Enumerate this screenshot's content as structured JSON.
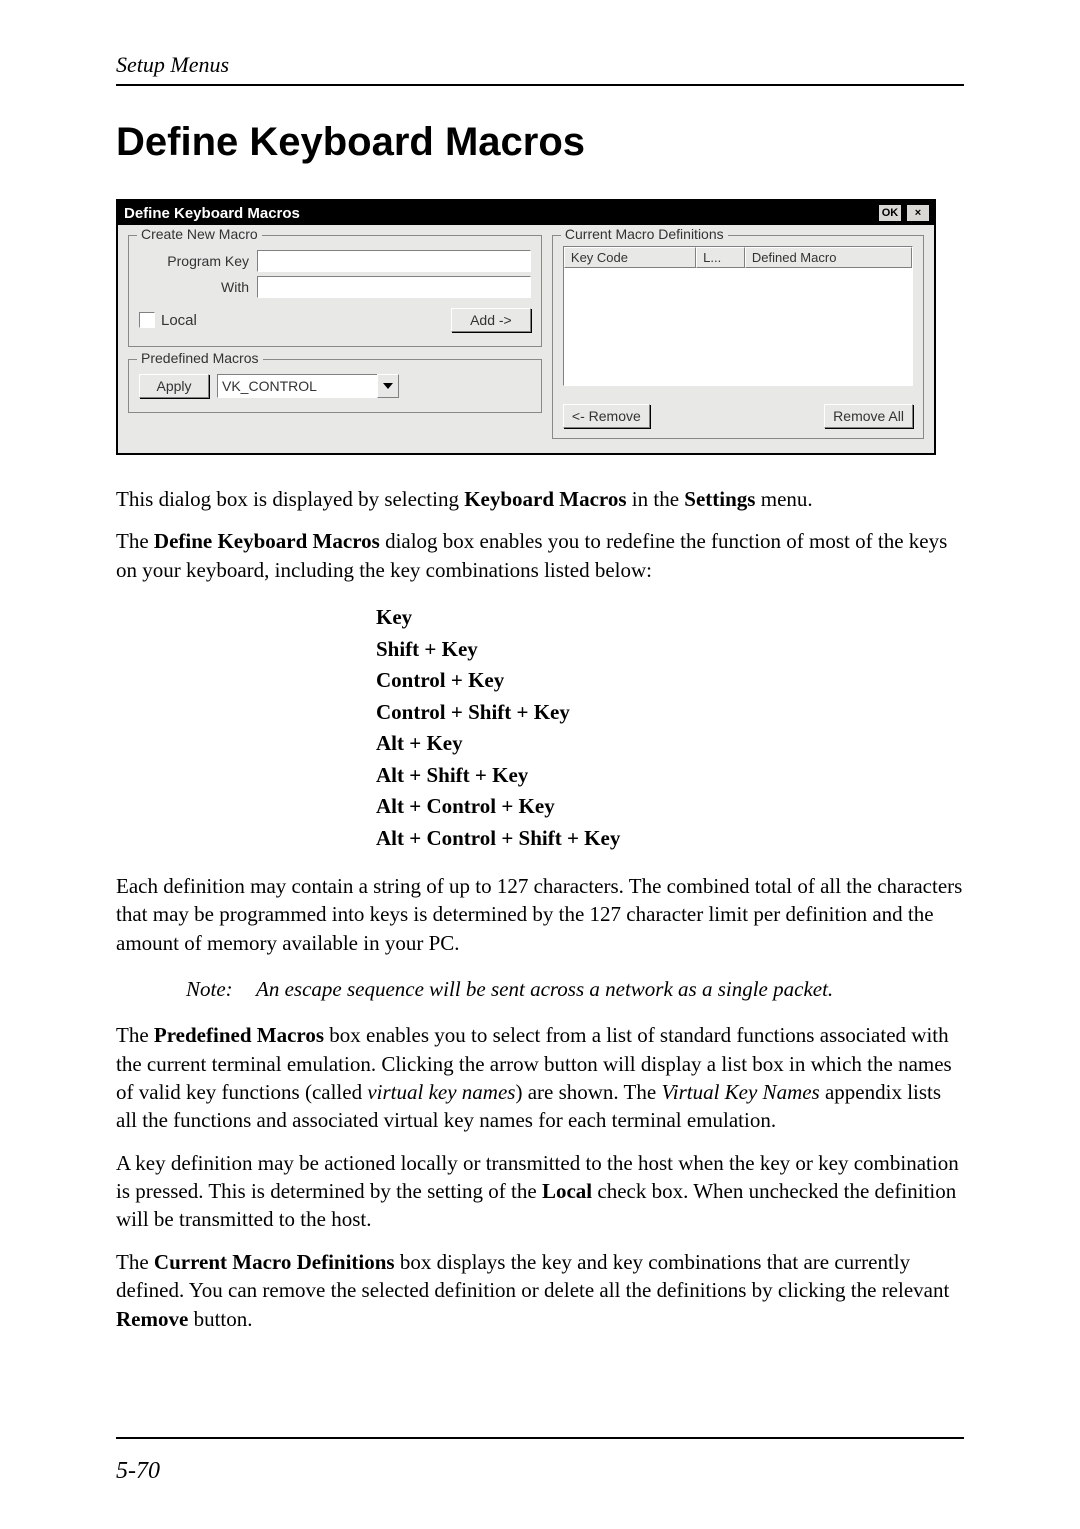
{
  "header": {
    "running": "Setup Menus"
  },
  "title": "Define Keyboard Macros",
  "dialog": {
    "title": "Define Keyboard Macros",
    "ok_label": "OK",
    "close_label": "×",
    "create_legend": "Create New Macro",
    "program_key_label": "Program Key",
    "with_label": "With",
    "local_label": "Local",
    "add_label": "Add ->",
    "predef_legend": "Predefined Macros",
    "apply_label": "Apply",
    "combo_value": "VK_CONTROL",
    "defs_legend": "Current Macro Definitions",
    "col_key": "Key Code",
    "col_l": "L...",
    "col_macro": "Defined Macro",
    "remove_label": "<- Remove",
    "remove_all_label": "Remove All"
  },
  "para1_a": "This dialog box is displayed by selecting ",
  "para1_b": "Keyboard Macros",
  "para1_c": " in the ",
  "para1_d": "Settings",
  "para1_e": " menu.",
  "para2_a": "The ",
  "para2_b": "Define Keyboard Macros",
  "para2_c": " dialog box enables you to redefine the function of most of the keys on your keyboard, including the key combinations listed below:",
  "keycombos": {
    "k0": "Key",
    "k1": "Shift + Key",
    "k2": "Control + Key",
    "k3": "Control + Shift + Key",
    "k4": "Alt + Key",
    "k5": "Alt + Shift + Key",
    "k6": "Alt + Control + Key",
    "k7": "Alt + Control + Shift + Key"
  },
  "para3": "Each definition may contain a string of up to 127 characters. The combined total of all the characters that may be programmed into keys is determined by the 127 character limit per definition and the amount of memory available in your PC.",
  "note_label": "Note:",
  "note_text": "An escape sequence will be sent across a network as a single packet.",
  "para4_a": "The ",
  "para4_b": "Predefined Macros",
  "para4_c": " box enables you to select from a list of standard functions associated with the current terminal emulation. Clicking the arrow button will display a list box in which the names of valid key functions (called ",
  "para4_d": "virtual key names",
  "para4_e": ") are shown. The ",
  "para4_f": "Virtual Key Names",
  "para4_g": " appendix lists all the functions and associated virtual key names for each terminal emulation.",
  "para5_a": "A key definition may be actioned locally or transmitted to the host when the key or key combination is pressed. This is determined by the setting of the ",
  "para5_b": "Local",
  "para5_c": " check box. When unchecked the definition will be transmitted to the host.",
  "para6_a": "The ",
  "para6_b": "Current Macro Definitions",
  "para6_c": " box displays the key and key combinations that are currently defined. You can remove the selected definition or delete all the definitions by clicking the relevant ",
  "para6_d": "Remove",
  "para6_e": " button.",
  "page_number": "5-70"
}
